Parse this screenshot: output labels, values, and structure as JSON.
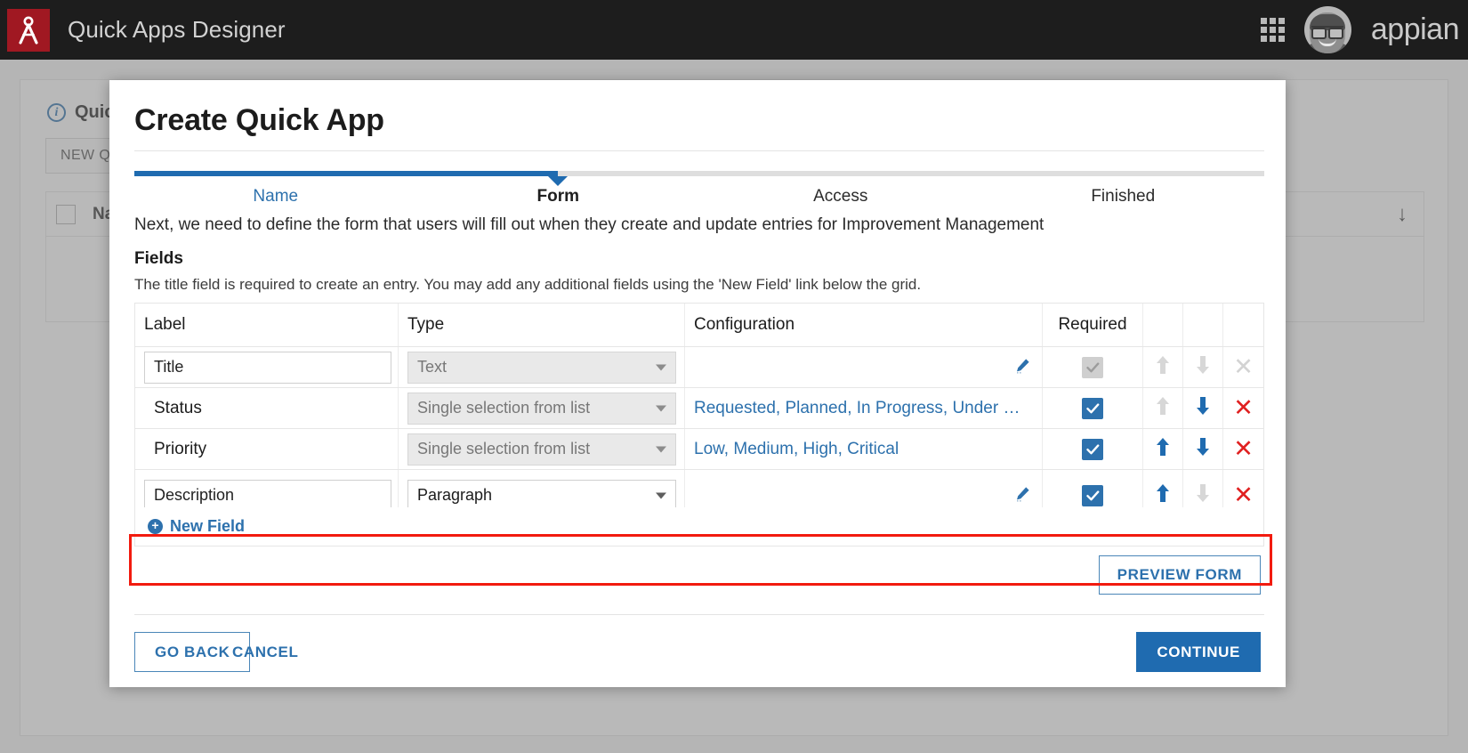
{
  "topbar": {
    "app_title": "Quick Apps Designer",
    "brand": "appian",
    "grid_icon": "apps-grid-icon",
    "avatar_alt": "user-avatar",
    "logo_icon": "appian-compass-logo"
  },
  "background_page": {
    "heading": "Quick",
    "info_icon": "info-icon",
    "new_button": "NEW QUI",
    "table": {
      "select_all": "",
      "columns": [
        "Na"
      ],
      "sort_icon": "sort-descending-arrow"
    }
  },
  "modal": {
    "title": "Create Quick App",
    "stepper": {
      "steps": [
        {
          "label": "Name",
          "state": "link"
        },
        {
          "label": "Form",
          "state": "active"
        },
        {
          "label": "Access",
          "state": "future"
        },
        {
          "label": "Finished",
          "state": "future"
        }
      ],
      "progress_percent": 37.5
    },
    "intro_text": "Next, we need to define the form that users will fill out when they create and update entries for Improvement Management",
    "fields_heading": "Fields",
    "fields_subtext": "The title field is required to create an entry. You may add any additional fields using the 'New Field' link below the grid.",
    "grid": {
      "columns": [
        "Label",
        "Type",
        "Configuration",
        "Required",
        "",
        "",
        ""
      ],
      "rows": [
        {
          "label": "Title",
          "label_editable": true,
          "type": "Text",
          "type_disabled": true,
          "configuration": "",
          "config_is_link": false,
          "has_pencil": true,
          "pencil_enabled": true,
          "required": true,
          "required_enabled": false,
          "move_up_enabled": false,
          "move_down_enabled": false,
          "delete_enabled": false,
          "highlighted": false
        },
        {
          "label": "Status",
          "label_editable": false,
          "type": "Single selection from list",
          "type_disabled": true,
          "configuration": "Requested, Planned, In Progress, Under Review, C…",
          "config_is_link": true,
          "has_pencil": false,
          "pencil_enabled": false,
          "required": true,
          "required_enabled": true,
          "move_up_enabled": false,
          "move_down_enabled": true,
          "delete_enabled": true,
          "highlighted": false
        },
        {
          "label": "Priority",
          "label_editable": false,
          "type": "Single selection from list",
          "type_disabled": true,
          "configuration": "Low, Medium, High, Critical",
          "config_is_link": true,
          "has_pencil": false,
          "pencil_enabled": false,
          "required": true,
          "required_enabled": true,
          "move_up_enabled": true,
          "move_down_enabled": true,
          "delete_enabled": true,
          "highlighted": false
        },
        {
          "label": "Description",
          "label_editable": true,
          "type": "Paragraph",
          "type_disabled": false,
          "configuration": "",
          "config_is_link": false,
          "has_pencil": true,
          "pencil_enabled": true,
          "required": true,
          "required_enabled": true,
          "move_up_enabled": true,
          "move_down_enabled": false,
          "delete_enabled": true,
          "highlighted": true
        }
      ]
    },
    "new_field_label": "New Field",
    "preview_button": "PREVIEW FORM",
    "footer": {
      "go_back": "GO BACK",
      "cancel": "CANCEL",
      "continue": "CONTINUE"
    }
  },
  "colors": {
    "accent_blue": "#2d71ad",
    "progress_blue": "#1f6bb0",
    "brand_red": "#a01822",
    "highlight_red": "#f21b0f",
    "delete_red": "#e02020",
    "topbar_dark": "#1d1d1d"
  }
}
